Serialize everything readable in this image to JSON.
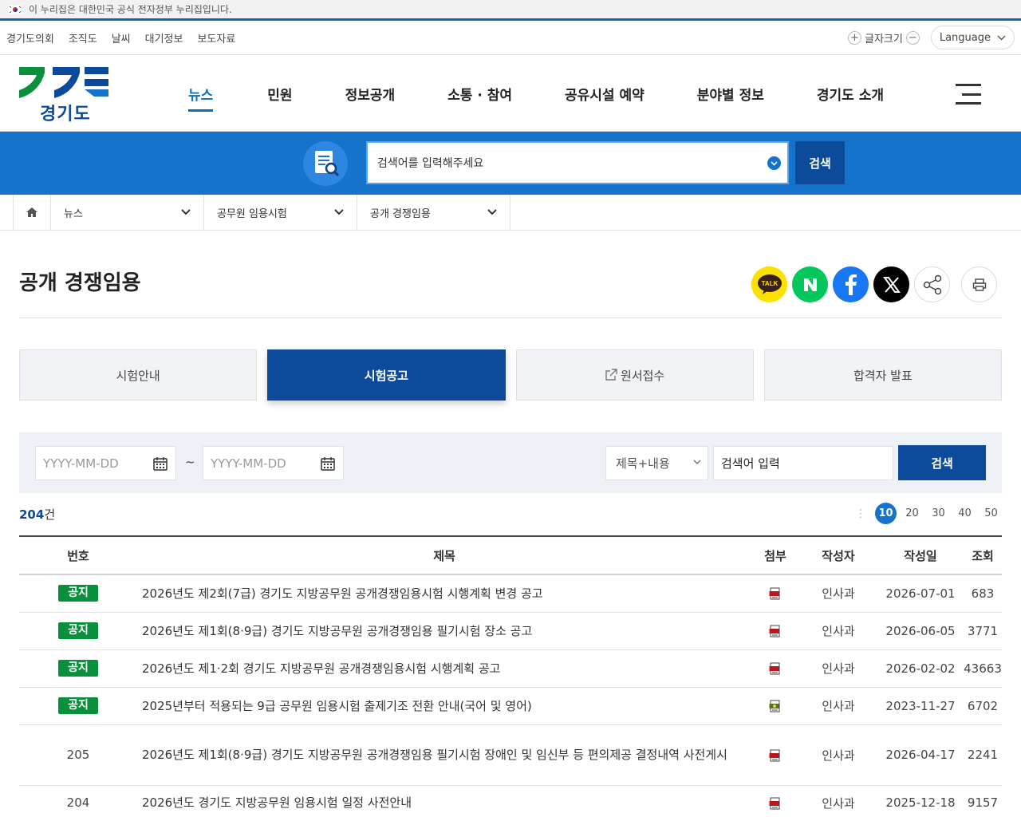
{
  "gov_banner": {
    "text": "이 누리집은 대한민국 공식 전자정부 누리집입니다."
  },
  "util": {
    "links": [
      "경기도의회",
      "조직도",
      "날씨",
      "대기정보",
      "보도자료"
    ],
    "fontsize_label": "글자크기",
    "plus": "+",
    "minus": "−",
    "language": "Language"
  },
  "logo": {
    "text": "경기도"
  },
  "nav": [
    "뉴스",
    "민원",
    "정보공개",
    "소통 · 참여",
    "공유시설 예약",
    "분야별 정보",
    "경기도 소개"
  ],
  "search": {
    "placeholder": "검색어를 입력해주세요",
    "button": "검색"
  },
  "breadcrumb": [
    "뉴스",
    "공무원 임용시험",
    "공개 경쟁임용"
  ],
  "page": {
    "title": "공개 경쟁임용"
  },
  "share": {
    "kakao_label": "TALK"
  },
  "tabs": [
    {
      "label": "시험안내",
      "active": false
    },
    {
      "label": "시험공고",
      "active": true
    },
    {
      "label": "원서접수",
      "active": false,
      "external": true
    },
    {
      "label": "합격자 발표",
      "active": false
    }
  ],
  "filter": {
    "date_placeholder_start": "YYYY-MM-DD",
    "date_placeholder_end": "YYYY-MM-DD",
    "tilde": "~",
    "select_value": "제목+내용",
    "keyword_placeholder": "검색어 입력",
    "button": "검색"
  },
  "list": {
    "count_num": "204",
    "count_unit": "건",
    "page_sizes": [
      "10",
      "20",
      "30",
      "40",
      "50"
    ],
    "selected_size": "10"
  },
  "table": {
    "headers": [
      "번호",
      "제목",
      "첨부",
      "작성자",
      "작성일",
      "조회"
    ],
    "notice_label": "공지",
    "rows": [
      {
        "no": "공지",
        "notice": true,
        "title": "2026년도 제2회(7급) 경기도 지방공무원 공개경쟁임용시험 시행계획 변경 공고",
        "file": "pdf",
        "author": "인사과",
        "date": "2026-07-01",
        "views": "683"
      },
      {
        "no": "공지",
        "notice": true,
        "title": "2026년도 제1회(8·9급) 경기도 지방공무원 공개경쟁임용 필기시험 장소 공고",
        "file": "pdf",
        "author": "인사과",
        "date": "2026-06-05",
        "views": "3771"
      },
      {
        "no": "공지",
        "notice": true,
        "title": "2026년도 제1·2회 경기도 지방공무원 공개경쟁임용시험 시행계획 공고",
        "file": "pdf",
        "author": "인사과",
        "date": "2026-02-02",
        "views": "43663"
      },
      {
        "no": "공지",
        "notice": true,
        "title": "2025년부터 적용되는 9급 공무원 임용시험 출제기조 전환 안내(국어 및 영어)",
        "file": "img",
        "author": "인사과",
        "date": "2023-11-27",
        "views": "6702"
      },
      {
        "no": "205",
        "notice": false,
        "title": "2026년도 제1회(8·9급) 경기도 지방공무원 공개경쟁임용 필기시험 장애인 및 임신부 등 편의제공 결정내역 사전게시",
        "file": "pdf",
        "author": "인사과",
        "date": "2026-04-17",
        "views": "2241"
      },
      {
        "no": "204",
        "notice": false,
        "title": "2026년도 경기도 지방공무원 임용시험 일정 사전안내",
        "file": "pdf",
        "author": "인사과",
        "date": "2025-12-18",
        "views": "9157"
      }
    ]
  },
  "colors": {
    "primary": "#0c4a9a",
    "accent": "#1673cc",
    "notice": "#0a8f3c"
  }
}
